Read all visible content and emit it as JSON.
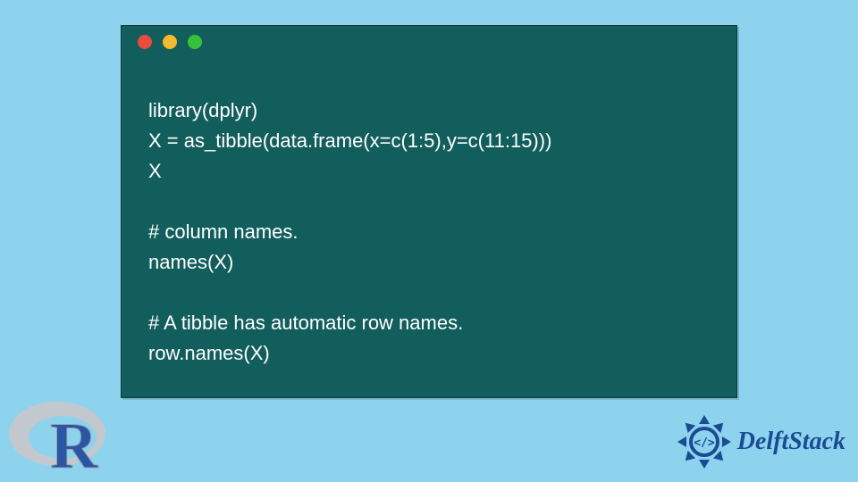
{
  "code": {
    "lines": [
      "library(dplyr)",
      "X = as_tibble(data.frame(x=c(1:5),y=c(11:15)))",
      "X",
      "",
      "# column names.",
      "names(X)",
      "",
      "# A tibble has automatic row names.",
      "row.names(X)"
    ]
  },
  "window": {
    "dot_red": "#e94b3c",
    "dot_yellow": "#f5b82e",
    "dot_green": "#36c23b",
    "bg": "#125e5d"
  },
  "branding": {
    "delft_label": "DelftStack",
    "r_logo_letter": "R"
  }
}
